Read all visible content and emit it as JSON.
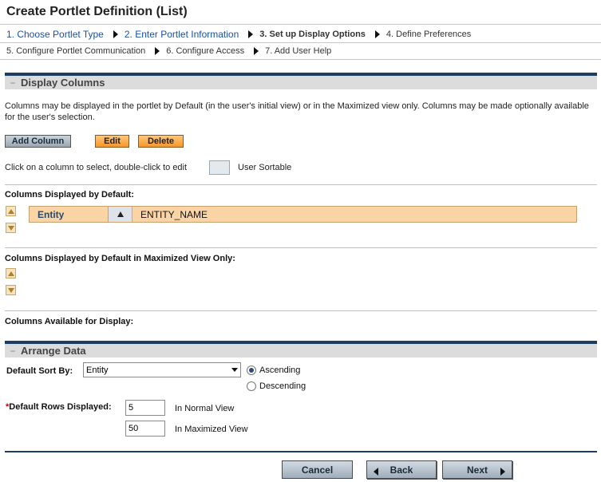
{
  "page": {
    "title": "Create Portlet Definition (List)"
  },
  "steps": {
    "row1": [
      {
        "label": "1. Choose Portlet Type",
        "state": "link"
      },
      {
        "label": "2. Enter Portlet Information",
        "state": "link"
      },
      {
        "label": "3. Set up Display Options",
        "state": "current"
      },
      {
        "label": "4. Define Preferences",
        "state": "plain"
      }
    ],
    "row2": [
      {
        "label": "5. Configure Portlet Communication",
        "state": "plain"
      },
      {
        "label": "6. Configure Access",
        "state": "plain"
      },
      {
        "label": "7. Add User Help",
        "state": "plain"
      }
    ]
  },
  "display_columns": {
    "toggle": "−",
    "title": "Display Columns",
    "description": "Columns may be displayed in the portlet by Default (in the user's initial view) or in the Maximized view only. Columns may be made optionally available for the user's selection.",
    "add_label": "Add Column",
    "edit_label": "Edit",
    "delete_label": "Delete",
    "hint": "Click on a column to select, double-click to edit",
    "sortable_label": "User Sortable",
    "default_heading": "Columns Displayed by Default:",
    "default_columns": [
      {
        "name": "Entity",
        "token": "ENTITY_NAME"
      }
    ],
    "maximized_heading": "Columns Displayed by Default in Maximized View Only:",
    "available_heading": "Columns Available for Display:"
  },
  "arrange_data": {
    "toggle": "−",
    "title": "Arrange Data",
    "sort_label": "Default Sort By:",
    "sort_value": "Entity",
    "ascending_label": "Ascending",
    "descending_label": "Descending",
    "required_mark": "*",
    "rows_label": "Default Rows Displayed:",
    "normal_value": "5",
    "normal_label": "In Normal View",
    "maximized_value": "50",
    "maximized_label": "In Maximized View"
  },
  "footer": {
    "cancel_label": "Cancel",
    "back_label": "Back",
    "next_label": "Next"
  }
}
